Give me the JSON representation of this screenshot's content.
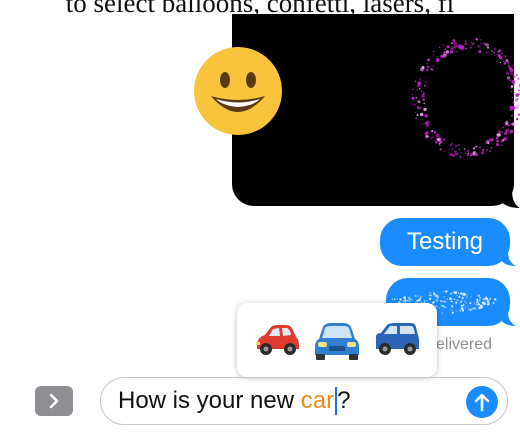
{
  "caption": {
    "text": "to select balloons, confetti, lasers, fi"
  },
  "conversation": {
    "media_bubble": {
      "effect_icon": "smiley-face-icon",
      "animation": "confetti-ring-icon"
    },
    "messages": [
      {
        "text": "Testing",
        "sender": "me"
      },
      {
        "text": "",
        "sender": "me",
        "effect": "sparkle-invisible-ink"
      }
    ],
    "status": "elivered"
  },
  "emoji_suggestions": {
    "items": [
      {
        "name": "red-car-emoji"
      },
      {
        "name": "blue-car-front-emoji"
      },
      {
        "name": "blue-suv-emoji"
      }
    ]
  },
  "composer": {
    "expand_icon": "chevron-right-icon",
    "typed_prefix": "How is your new ",
    "typed_highlight": "car",
    "typed_suffix": "?",
    "send_icon": "arrow-up-icon"
  },
  "colors": {
    "bubble_blue": "#1a8cff",
    "highlight_orange": "#f28a1a",
    "confetti_magenta": "#c020c8"
  }
}
